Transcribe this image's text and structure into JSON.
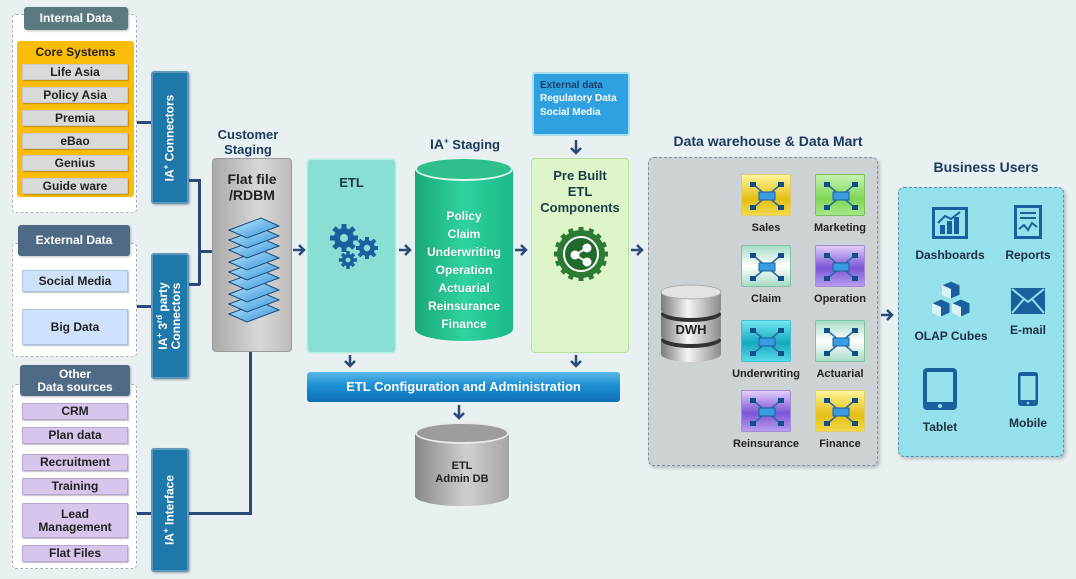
{
  "internal_data": {
    "header": "Internal Data",
    "core_systems": {
      "title": "Core Systems",
      "items": [
        "Life Asia",
        "Policy Asia",
        "Premia",
        "eBao",
        "Genius",
        "Guide ware"
      ]
    }
  },
  "external_data": {
    "header": "External Data",
    "items": [
      "Social Media",
      "Big Data"
    ]
  },
  "other_data": {
    "header_line1": "Other",
    "header_line2": "Data sources",
    "items": [
      "CRM",
      "Plan data",
      "Recruitment",
      "Training",
      "Lead Management",
      "Flat Files"
    ]
  },
  "connectors": {
    "ia_connectors": {
      "prefix": "IA",
      "sup": "+",
      "label": "Connectors"
    },
    "third_party": {
      "prefix": "IA",
      "sup": "+",
      "mid": "3",
      "mid_sup": "rd",
      "label": " party",
      "line2": "Connectors"
    },
    "interface": {
      "prefix": "IA",
      "sup": "+",
      "label": "Interface"
    }
  },
  "customer_staging": {
    "title_line1": "Customer",
    "title_line2": "Staging",
    "box_line1": "Flat file",
    "box_line2": "/RDBM"
  },
  "etl": {
    "title": "ETL"
  },
  "ia_staging": {
    "title_prefix": "IA",
    "title_sup": "+",
    "title_label": " Staging",
    "items": [
      "Policy",
      "Claim",
      "Underwriting",
      "Operation",
      "Actuarial",
      "Reinsurance",
      "Finance"
    ]
  },
  "external_feed": {
    "header": "External data",
    "items": [
      "Regulatory Data",
      "Social Media"
    ]
  },
  "prebuilt": {
    "line1": "Pre Built",
    "line2": "ETL",
    "line3": "Components"
  },
  "etl_config": {
    "label": "ETL Configuration and Administration"
  },
  "etl_admin_db": {
    "line1": "ETL",
    "line2": "Admin DB"
  },
  "dwh": {
    "title": "Data warehouse & Data Mart",
    "cylinder_label": "DWH",
    "marts": [
      {
        "label": "Sales",
        "color": "#e3be14"
      },
      {
        "label": "Marketing",
        "color": "#7fd658"
      },
      {
        "label": "Claim",
        "color": "#ffffff"
      },
      {
        "label": "Operation",
        "color": "#7b55d6"
      },
      {
        "label": "Underwriting",
        "color": "#16a8bd"
      },
      {
        "label": "Actuarial",
        "color": "#ffffff"
      },
      {
        "label": "Reinsurance",
        "color": "#7b55d6"
      },
      {
        "label": "Finance",
        "color": "#e3be14"
      }
    ]
  },
  "business_users": {
    "title": "Business Users",
    "items": [
      {
        "label": "Dashboards",
        "icon": "dashboard-chart-icon"
      },
      {
        "label": "Reports",
        "icon": "report-icon"
      },
      {
        "label": "OLAP Cubes",
        "icon": "cubes-icon"
      },
      {
        "label": "E-mail",
        "icon": "envelope-icon"
      },
      {
        "label": "Tablet",
        "icon": "tablet-icon"
      },
      {
        "label": "Mobile",
        "icon": "mobile-icon"
      }
    ]
  },
  "colors": {
    "background": "#e8f0f2",
    "connector": "#1f78aa",
    "line": "#2b4a78",
    "core_systems": "#fbbc0a",
    "ia_staging": "#2fd3a0",
    "etl": "#8adfd4",
    "prebuilt": "#ddf5c8",
    "business_users": "#94e1ec",
    "icon_blue": "#1a5f9e"
  }
}
